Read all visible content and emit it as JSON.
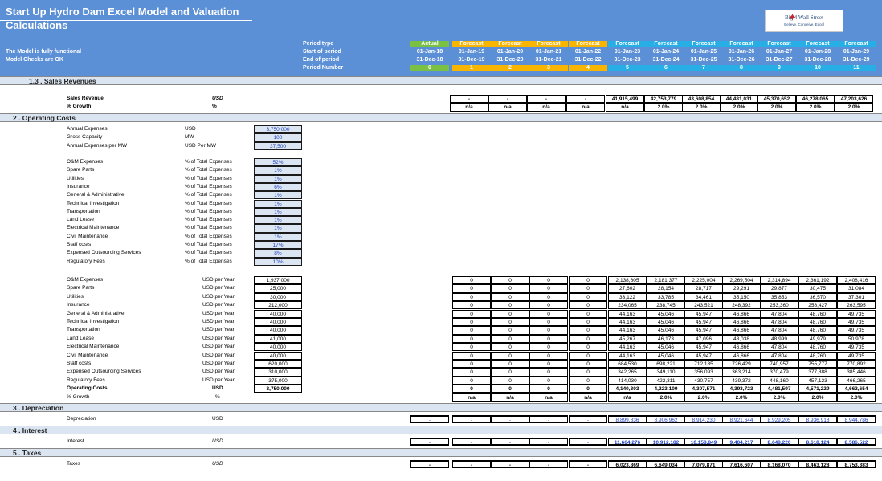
{
  "header": {
    "title": "Start Up Hydro Dam Excel Model and Valuation",
    "subtitle": "Calculations",
    "status1": "The Model is fully functional",
    "status2": "Model Checks are OK",
    "logo_main": "Big 4 Wall Street",
    "logo_tag": "Believe, Conceive, Excel",
    "row_labels": [
      "Period type",
      "Start of period",
      "End of period",
      "Period Number"
    ]
  },
  "periods": [
    {
      "type": "Actual",
      "start": "01-Jan-18",
      "end": "31-Dec-18",
      "num": "0",
      "color": "#7ac143"
    },
    {
      "type": "Forecast",
      "start": "01-Jan-19",
      "end": "31-Dec-19",
      "num": "1",
      "color": "#f7b500"
    },
    {
      "type": "Forecast",
      "start": "01-Jan-20",
      "end": "31-Dec-20",
      "num": "2",
      "color": "#f7b500"
    },
    {
      "type": "Forecast",
      "start": "01-Jan-21",
      "end": "31-Dec-21",
      "num": "3",
      "color": "#f7b500"
    },
    {
      "type": "Forecast",
      "start": "01-Jan-22",
      "end": "31-Dec-22",
      "num": "4",
      "color": "#f7b500"
    },
    {
      "type": "Forecast",
      "start": "01-Jan-23",
      "end": "31-Dec-23",
      "num": "5",
      "color": "#26aee5"
    },
    {
      "type": "Forecast",
      "start": "01-Jan-24",
      "end": "31-Dec-24",
      "num": "6",
      "color": "#26aee5"
    },
    {
      "type": "Forecast",
      "start": "01-Jan-25",
      "end": "31-Dec-25",
      "num": "7",
      "color": "#26aee5"
    },
    {
      "type": "Forecast",
      "start": "01-Jan-26",
      "end": "31-Dec-26",
      "num": "8",
      "color": "#26aee5"
    },
    {
      "type": "Forecast",
      "start": "01-Jan-27",
      "end": "31-Dec-27",
      "num": "9",
      "color": "#26aee5"
    },
    {
      "type": "Forecast",
      "start": "01-Jan-28",
      "end": "31-Dec-28",
      "num": "10",
      "color": "#26aee5"
    },
    {
      "type": "Forecast",
      "start": "01-Jan-29",
      "end": "31-Dec-29",
      "num": "11",
      "color": "#26aee5"
    }
  ],
  "sections": {
    "revenue": "1.3 . Sales Revenues",
    "opex": "2 . Operating Costs",
    "depr": "3 . Depreciation",
    "interest": "4 . Interest",
    "taxes": "5 . Taxes"
  },
  "revenue_rows": [
    {
      "label": "Sales Revenue",
      "unit": "USD",
      "values": [
        "-",
        "-",
        "-",
        "-",
        "-",
        "41,915,499",
        "42,753,779",
        "43,608,854",
        "44,481,031",
        "45,370,652",
        "46,278,065",
        "47,203,626"
      ]
    },
    {
      "label": "% Growth",
      "unit": "%",
      "values": [
        "n/a",
        "n/a",
        "n/a",
        "n/a",
        "n/a",
        "n/a",
        "2.0%",
        "2.0%",
        "2.0%",
        "2.0%",
        "2.0%",
        "2.0%"
      ]
    }
  ],
  "assumptions": [
    {
      "label": "Annual Expenses",
      "unit": "USD",
      "value": "3,750,000"
    },
    {
      "label": "Gross Capacity",
      "unit": "MW",
      "value": "100"
    },
    {
      "label": "Annual Expenses per MW",
      "unit": "USD Per MW",
      "value": "37,500"
    }
  ],
  "pct_rows": [
    {
      "label": "O&M Expenses",
      "unit": "% of Total Expenses",
      "value": "52%"
    },
    {
      "label": "Spare Parts",
      "unit": "% of Total Expenses",
      "value": "1%"
    },
    {
      "label": "Utilities",
      "unit": "% of Total Expenses",
      "value": "1%"
    },
    {
      "label": "Insurance",
      "unit": "% of Total Expenses",
      "value": "6%"
    },
    {
      "label": "General & Administrative",
      "unit": "% of Total Expenses",
      "value": "1%"
    },
    {
      "label": "Technical Investigation",
      "unit": "% of Total Expenses",
      "value": "1%"
    },
    {
      "label": "Transportation",
      "unit": "% of Total Expenses",
      "value": "1%"
    },
    {
      "label": "Land Lease",
      "unit": "% of Total Expenses",
      "value": "1%"
    },
    {
      "label": "Electrical Maintenance",
      "unit": "% of Total Expenses",
      "value": "1%"
    },
    {
      "label": "Civil Maintenance",
      "unit": "% of Total Expenses",
      "value": "1%"
    },
    {
      "label": "Staff costs",
      "unit": "% of Total Expenses",
      "value": "17%"
    },
    {
      "label": "Expensed Outsourcing Services",
      "unit": "% of Total Expenses",
      "value": "8%"
    },
    {
      "label": "Regulatory Fees",
      "unit": "% of Total Expenses",
      "value": "10%"
    }
  ],
  "cost_rows": [
    {
      "label": "O&M Expenses",
      "unit": "USD per Year",
      "base": "1,937,000",
      "values": [
        "0",
        "0",
        "0",
        "0",
        "2,138,605",
        "2,181,377",
        "2,225,004",
        "2,269,504",
        "2,314,894",
        "2,361,192",
        "2,408,416"
      ]
    },
    {
      "label": "Spare Parts",
      "unit": "USD per Year",
      "base": "25,000",
      "values": [
        "0",
        "0",
        "0",
        "0",
        "27,602",
        "28,154",
        "28,717",
        "29,291",
        "29,877",
        "30,475",
        "31,084"
      ]
    },
    {
      "label": "Utilities",
      "unit": "USD per Year",
      "base": "30,000",
      "values": [
        "0",
        "0",
        "0",
        "0",
        "33,122",
        "33,785",
        "34,461",
        "35,150",
        "35,853",
        "36,570",
        "37,301"
      ]
    },
    {
      "label": "Insurance",
      "unit": "USD per Year",
      "base": "212,000",
      "values": [
        "0",
        "0",
        "0",
        "0",
        "234,065",
        "238,745",
        "243,521",
        "248,392",
        "253,360",
        "258,427",
        "263,595"
      ]
    },
    {
      "label": "General & Administrative",
      "unit": "USD per Year",
      "base": "40,000",
      "values": [
        "0",
        "0",
        "0",
        "0",
        "44,163",
        "45,046",
        "45,947",
        "46,866",
        "47,804",
        "48,760",
        "49,735"
      ]
    },
    {
      "label": "Technical Investigation",
      "unit": "USD per Year",
      "base": "40,000",
      "values": [
        "0",
        "0",
        "0",
        "0",
        "44,163",
        "45,046",
        "45,947",
        "46,866",
        "47,804",
        "48,760",
        "49,735"
      ]
    },
    {
      "label": "Transportation",
      "unit": "USD per Year",
      "base": "40,000",
      "values": [
        "0",
        "0",
        "0",
        "0",
        "44,163",
        "45,046",
        "45,947",
        "46,866",
        "47,804",
        "48,760",
        "49,735"
      ]
    },
    {
      "label": "Land Lease",
      "unit": "USD per Year",
      "base": "41,000",
      "values": [
        "0",
        "0",
        "0",
        "0",
        "45,267",
        "46,173",
        "47,096",
        "48,038",
        "48,999",
        "49,979",
        "50,978"
      ]
    },
    {
      "label": "Electrical Maintenance",
      "unit": "USD per Year",
      "base": "40,000",
      "values": [
        "0",
        "0",
        "0",
        "0",
        "44,163",
        "45,046",
        "45,947",
        "46,866",
        "47,804",
        "48,760",
        "49,735"
      ]
    },
    {
      "label": "Civil Maintenance",
      "unit": "USD per Year",
      "base": "40,000",
      "values": [
        "0",
        "0",
        "0",
        "0",
        "44,163",
        "45,046",
        "45,947",
        "46,866",
        "47,804",
        "48,760",
        "49,735"
      ]
    },
    {
      "label": "Staff costs",
      "unit": "USD per Year",
      "base": "620,000",
      "values": [
        "0",
        "0",
        "0",
        "0",
        "684,530",
        "698,221",
        "712,185",
        "726,429",
        "740,957",
        "755,777",
        "770,892"
      ]
    },
    {
      "label": "Expensed Outsourcing Services",
      "unit": "USD per Year",
      "base": "310,000",
      "values": [
        "0",
        "0",
        "0",
        "0",
        "342,265",
        "349,110",
        "356,093",
        "363,214",
        "370,479",
        "377,888",
        "385,446"
      ]
    },
    {
      "label": "Regulatory Fees",
      "unit": "USD per Year",
      "base": "375,000",
      "values": [
        "0",
        "0",
        "0",
        "0",
        "414,030",
        "422,311",
        "430,757",
        "439,372",
        "448,160",
        "457,123",
        "466,265"
      ]
    }
  ],
  "opex_total": {
    "label": "Operating Costs",
    "unit": "USD",
    "base": "3,750,000",
    "values": [
      "0",
      "0",
      "0",
      "0",
      "4,140,303",
      "4,223,109",
      "4,307,571",
      "4,393,723",
      "4,481,597",
      "4,571,229",
      "4,662,654"
    ]
  },
  "opex_growth": {
    "label": "% Growth",
    "unit": "%",
    "values": [
      "n/a",
      "n/a",
      "n/a",
      "n/a",
      "n/a",
      "2.0%",
      "2.0%",
      "2.0%",
      "2.0%",
      "2.0%",
      "2.0%"
    ]
  },
  "depreciation": {
    "label": "Depreciation",
    "unit": "USD",
    "values": [
      "-",
      "-",
      "-",
      "-",
      "-",
      "8,899,836",
      "8,906,962",
      "8,914,230",
      "8,921,644",
      "8,929,205",
      "8,936,918",
      "8,944,786"
    ]
  },
  "interest": {
    "label": "Interest",
    "unit": "USD",
    "values": [
      "-",
      "-",
      "-",
      "-",
      "-",
      "11,664,276",
      "10,912,182",
      "10,158,849",
      "9,404,217",
      "8,648,220",
      "8,618,124",
      "8,586,522"
    ]
  },
  "taxes": {
    "label": "Taxes",
    "unit": "USD",
    "values": [
      "-",
      "-",
      "-",
      "-",
      "-",
      "6,023,869",
      "6,649,034",
      "7,079,871",
      "7,616,607",
      "8,168,070",
      "8,463,128",
      "8,753,383"
    ]
  }
}
